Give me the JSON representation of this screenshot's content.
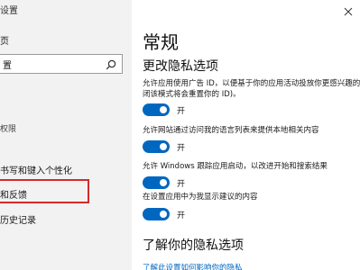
{
  "window": {
    "title": "设置"
  },
  "sidebar": {
    "home_label": "页",
    "search": {
      "value": "置"
    },
    "section_label": "权限",
    "items": [
      {
        "label": "书写和键入个性化"
      },
      {
        "label": "和反馈"
      },
      {
        "label": "历史记录"
      }
    ]
  },
  "main": {
    "page_title": "常规",
    "section_title": "更改隐私选项",
    "options": [
      {
        "desc_lines": [
          "允许应用使用广告 ID，以便基于你的应用活动投放你更感兴趣的广",
          "闭该模式将会重置你的 ID)。"
        ],
        "toggle_label": "开",
        "state": "on"
      },
      {
        "desc_lines": [
          "允许网站通过访问我的语言列表来提供本地相关内容"
        ],
        "toggle_label": "开",
        "state": "on"
      },
      {
        "desc_lines": [
          "允许 Windows 跟踪应用启动，以改进开始和搜索结果"
        ],
        "toggle_label": "开",
        "state": "on"
      },
      {
        "desc_lines": [
          "在设置应用中为我显示建议的内容"
        ],
        "toggle_label": "开",
        "state": "on"
      }
    ],
    "learn_title": "了解你的隐私选项",
    "learn_link": "了解此设置如何影响你的隐私"
  },
  "colors": {
    "accent": "#0067c0",
    "highlight": "#d42a2a",
    "sidebar_bg": "#f2f2f2"
  },
  "icons": {
    "search": "search-icon",
    "close": "close-icon"
  }
}
